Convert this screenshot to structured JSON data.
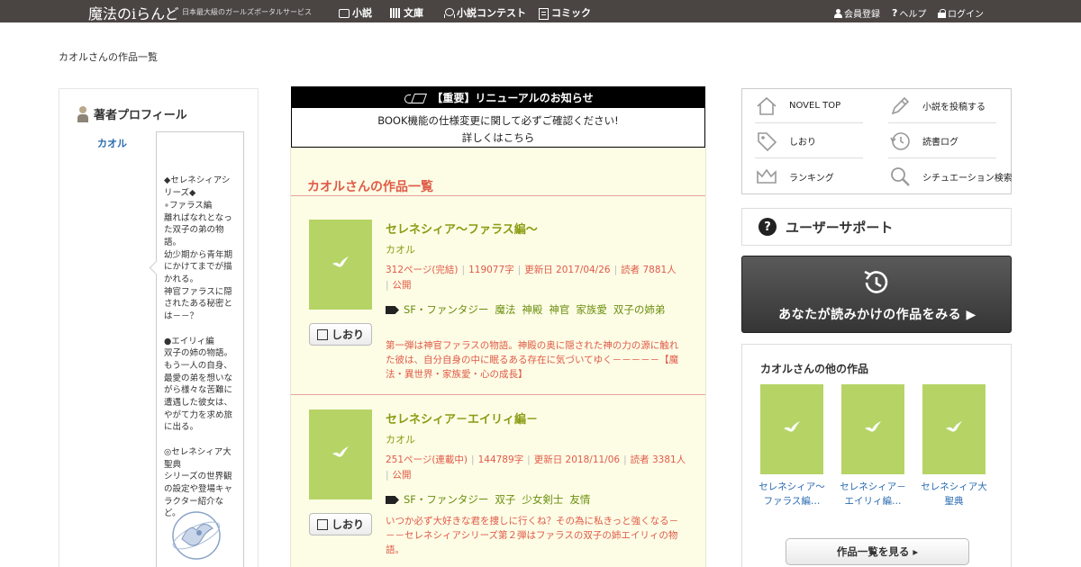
{
  "header": {
    "logo": "魔法のiらんど",
    "tagline": "日本最大級のガールズポータルサービス",
    "nav": [
      {
        "label": "小説",
        "icon": "book-icon"
      },
      {
        "label": "文庫",
        "icon": "bookshelf-icon"
      },
      {
        "label": "小説コンテスト",
        "icon": "ribbon-icon"
      },
      {
        "label": "コミック",
        "icon": "comic-icon"
      }
    ],
    "utility": [
      {
        "label": "会員登録",
        "icon": "person-icon"
      },
      {
        "label": "ヘルプ",
        "icon": "help-icon"
      },
      {
        "label": "ログイン",
        "icon": "lock-icon"
      }
    ]
  },
  "breadcrumb": "カオルさんの作品一覧",
  "profile": {
    "heading": "著者プロフィール",
    "author": "カオル",
    "bio": "◆セレネシィアシリーズ◆\n∘ファラス編\n離ればなれとなった双子の弟の物語。\n幼少期から青年期にかけてまでが描かれる。\n神官ファラスに隠されたある秘密とは－－？\n\n●エイリィ編\n双子の姉の物語。\nもう一人の自身、最愛の弟を想いながら様々な苦難に遭遇した彼女は、やがて力を求め旅に出る。\n\n◎セレネシィア大聖典\nシリーズの世界観の設定や登場キャラクター紹介など。"
  },
  "notice": {
    "title": "【重要】リニューアルのお知らせ",
    "line1": "BOOK機能の仕様変更に関して必ずご確認ください!",
    "line2": "詳しくはこちら"
  },
  "works": {
    "title": "カオルさんの作品一覧",
    "bookmark_label": "しおり",
    "items": [
      {
        "title": "セレネシィア～ファラス編～",
        "author": "カオル",
        "pages": "312ページ(完結)",
        "chars": "119077字",
        "updated": "更新日 2017/04/26",
        "readers": "読者 7881人",
        "visibility": "公開",
        "tags": [
          "SF・ファンタジー",
          "魔法",
          "神殿",
          "神官",
          "家族愛",
          "双子の姉弟"
        ],
        "description": "第一弾は神官ファラスの物語。神殿の奥に隠された神の力の源に触れた彼は、自分自身の中に眠るある存在に気づいてゆく－－－－－【魔法・異世界・家族愛・心の成長】"
      },
      {
        "title": "セレネシィア－エイリィ編－",
        "author": "カオル",
        "pages": "251ページ(連載中)",
        "chars": "144789字",
        "updated": "更新日 2018/11/06",
        "readers": "読者 3381人",
        "visibility": "公開",
        "tags": [
          "SF・ファンタジー",
          "双子",
          "少女剣士",
          "友情"
        ],
        "description": "いつか必ず大好きな君を捜しに行くね？その為に私きっと強くなる－－－セレネシィアシリーズ第２弾はファラスの双子の姉エイリィの物語。"
      }
    ]
  },
  "menu": {
    "items": [
      {
        "label": "NOVEL TOP",
        "icon": "home-icon"
      },
      {
        "label": "小説を投稿する",
        "icon": "pencil-icon"
      },
      {
        "label": "しおり",
        "icon": "tag-icon"
      },
      {
        "label": "読書ログ",
        "icon": "history-icon"
      },
      {
        "label": "ランキング",
        "icon": "crown-icon"
      },
      {
        "label": "シチュエーション検索",
        "icon": "search-icon"
      }
    ]
  },
  "support": {
    "label": "ユーザーサポート"
  },
  "reading": {
    "label": "あなたが読みかけの作品をみる ▶"
  },
  "other_works": {
    "title": "カオルさんの他の作品",
    "items": [
      {
        "title": "セレネシィア～ファラス編…"
      },
      {
        "title": "セレネシィア－エイリィ編…"
      },
      {
        "title": "セレネシィア大聖典"
      }
    ],
    "button": "作品一覧を見る ▸"
  },
  "colors": {
    "topbar": "#4a4543",
    "accent_red": "#e05a47",
    "title_green": "#8a9c12",
    "cover_green": "#b6d466",
    "list_bg": "#fdfde6",
    "link_blue": "#2b6cb0"
  }
}
